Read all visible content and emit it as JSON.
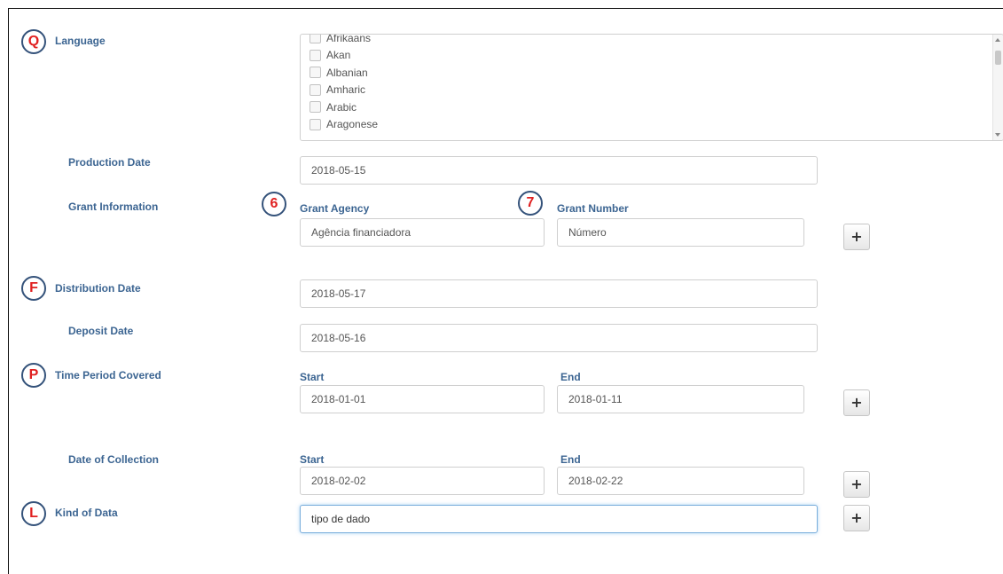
{
  "badges": {
    "language": "Q",
    "grant_agency": "6",
    "grant_number": "7",
    "distribution": "F",
    "time_period": "P",
    "kind_of_data": "L"
  },
  "language": {
    "label": "Language",
    "options": [
      "Afrikaans",
      "Akan",
      "Albanian",
      "Amharic",
      "Arabic",
      "Aragonese"
    ]
  },
  "production_date": {
    "label": "Production Date",
    "value": "2018-05-15"
  },
  "grant": {
    "label": "Grant Information",
    "agency_label": "Grant Agency",
    "agency_value": "Agência financiadora",
    "number_label": "Grant Number",
    "number_value": "Número",
    "add_label": "+"
  },
  "distribution_date": {
    "label": "Distribution Date",
    "value": "2018-05-17"
  },
  "deposit_date": {
    "label": "Deposit Date",
    "value": "2018-05-16"
  },
  "time_period": {
    "label": "Time Period Covered",
    "start_label": "Start",
    "start_value": "2018-01-01",
    "end_label": "End",
    "end_value": "2018-01-11",
    "add_label": "+"
  },
  "collection": {
    "label": "Date of Collection",
    "start_label": "Start",
    "start_value": "2018-02-02",
    "end_label": "End",
    "end_value": "2018-02-22",
    "add_label": "+"
  },
  "kind_of_data": {
    "label": "Kind of Data",
    "value": "tipo de dado",
    "add_label": "+"
  },
  "colors": {
    "label": "#3c6592",
    "badge_letter": "#e02020",
    "badge_ring": "#34527a"
  }
}
